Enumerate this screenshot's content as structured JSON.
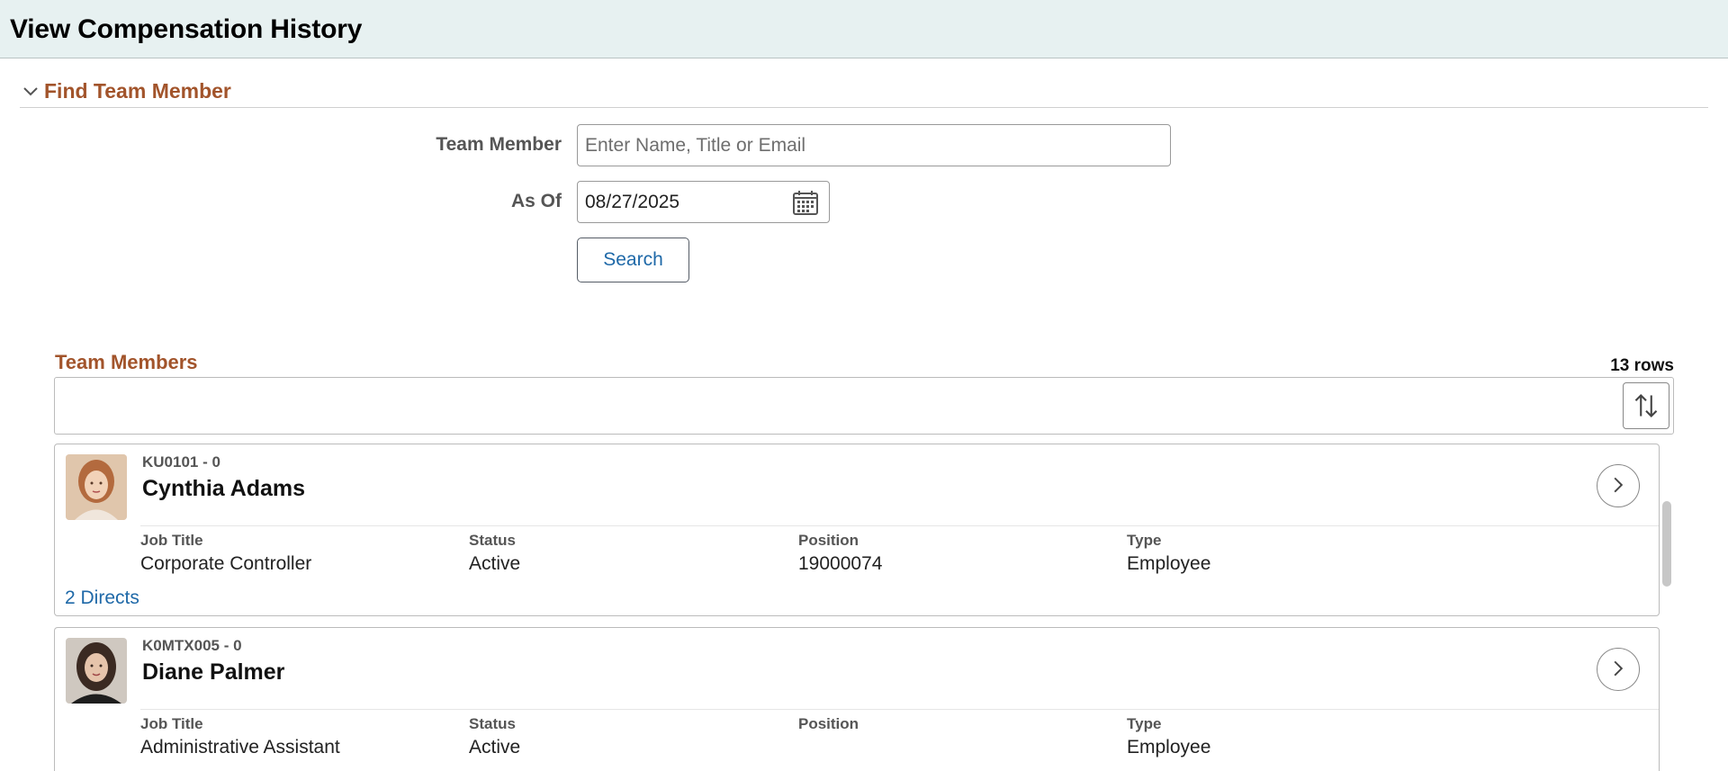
{
  "page": {
    "title": "View Compensation History"
  },
  "find": {
    "section_title": "Find Team Member",
    "team_member_label": "Team Member",
    "team_member_placeholder": "Enter Name, Title or Email",
    "team_member_value": "",
    "as_of_label": "As Of",
    "as_of_value": "08/27/2025",
    "search_label": "Search"
  },
  "list": {
    "title": "Team Members",
    "row_count": "13 rows",
    "members": [
      {
        "id": "KU0101 - 0",
        "name": "Cynthia Adams",
        "job_title_label": "Job Title",
        "job_title": "Corporate Controller",
        "status_label": "Status",
        "status": "Active",
        "position_label": "Position",
        "position": "19000074",
        "type_label": "Type",
        "type": "Employee",
        "directs": "2 Directs"
      },
      {
        "id": "K0MTX005 - 0",
        "name": "Diane Palmer",
        "job_title_label": "Job Title",
        "job_title": "Administrative Assistant",
        "status_label": "Status",
        "status": "Active",
        "position_label": "Position",
        "position": "",
        "type_label": "Type",
        "type": "Employee"
      }
    ]
  },
  "icons": {
    "collapse": "chevron-down-icon",
    "calendar": "calendar-icon",
    "sort": "sort-icon",
    "details": "chevron-right-icon"
  },
  "colors": {
    "accent": "#a2542b",
    "link": "#1f69a8",
    "header_bg": "#e7f1f1"
  }
}
